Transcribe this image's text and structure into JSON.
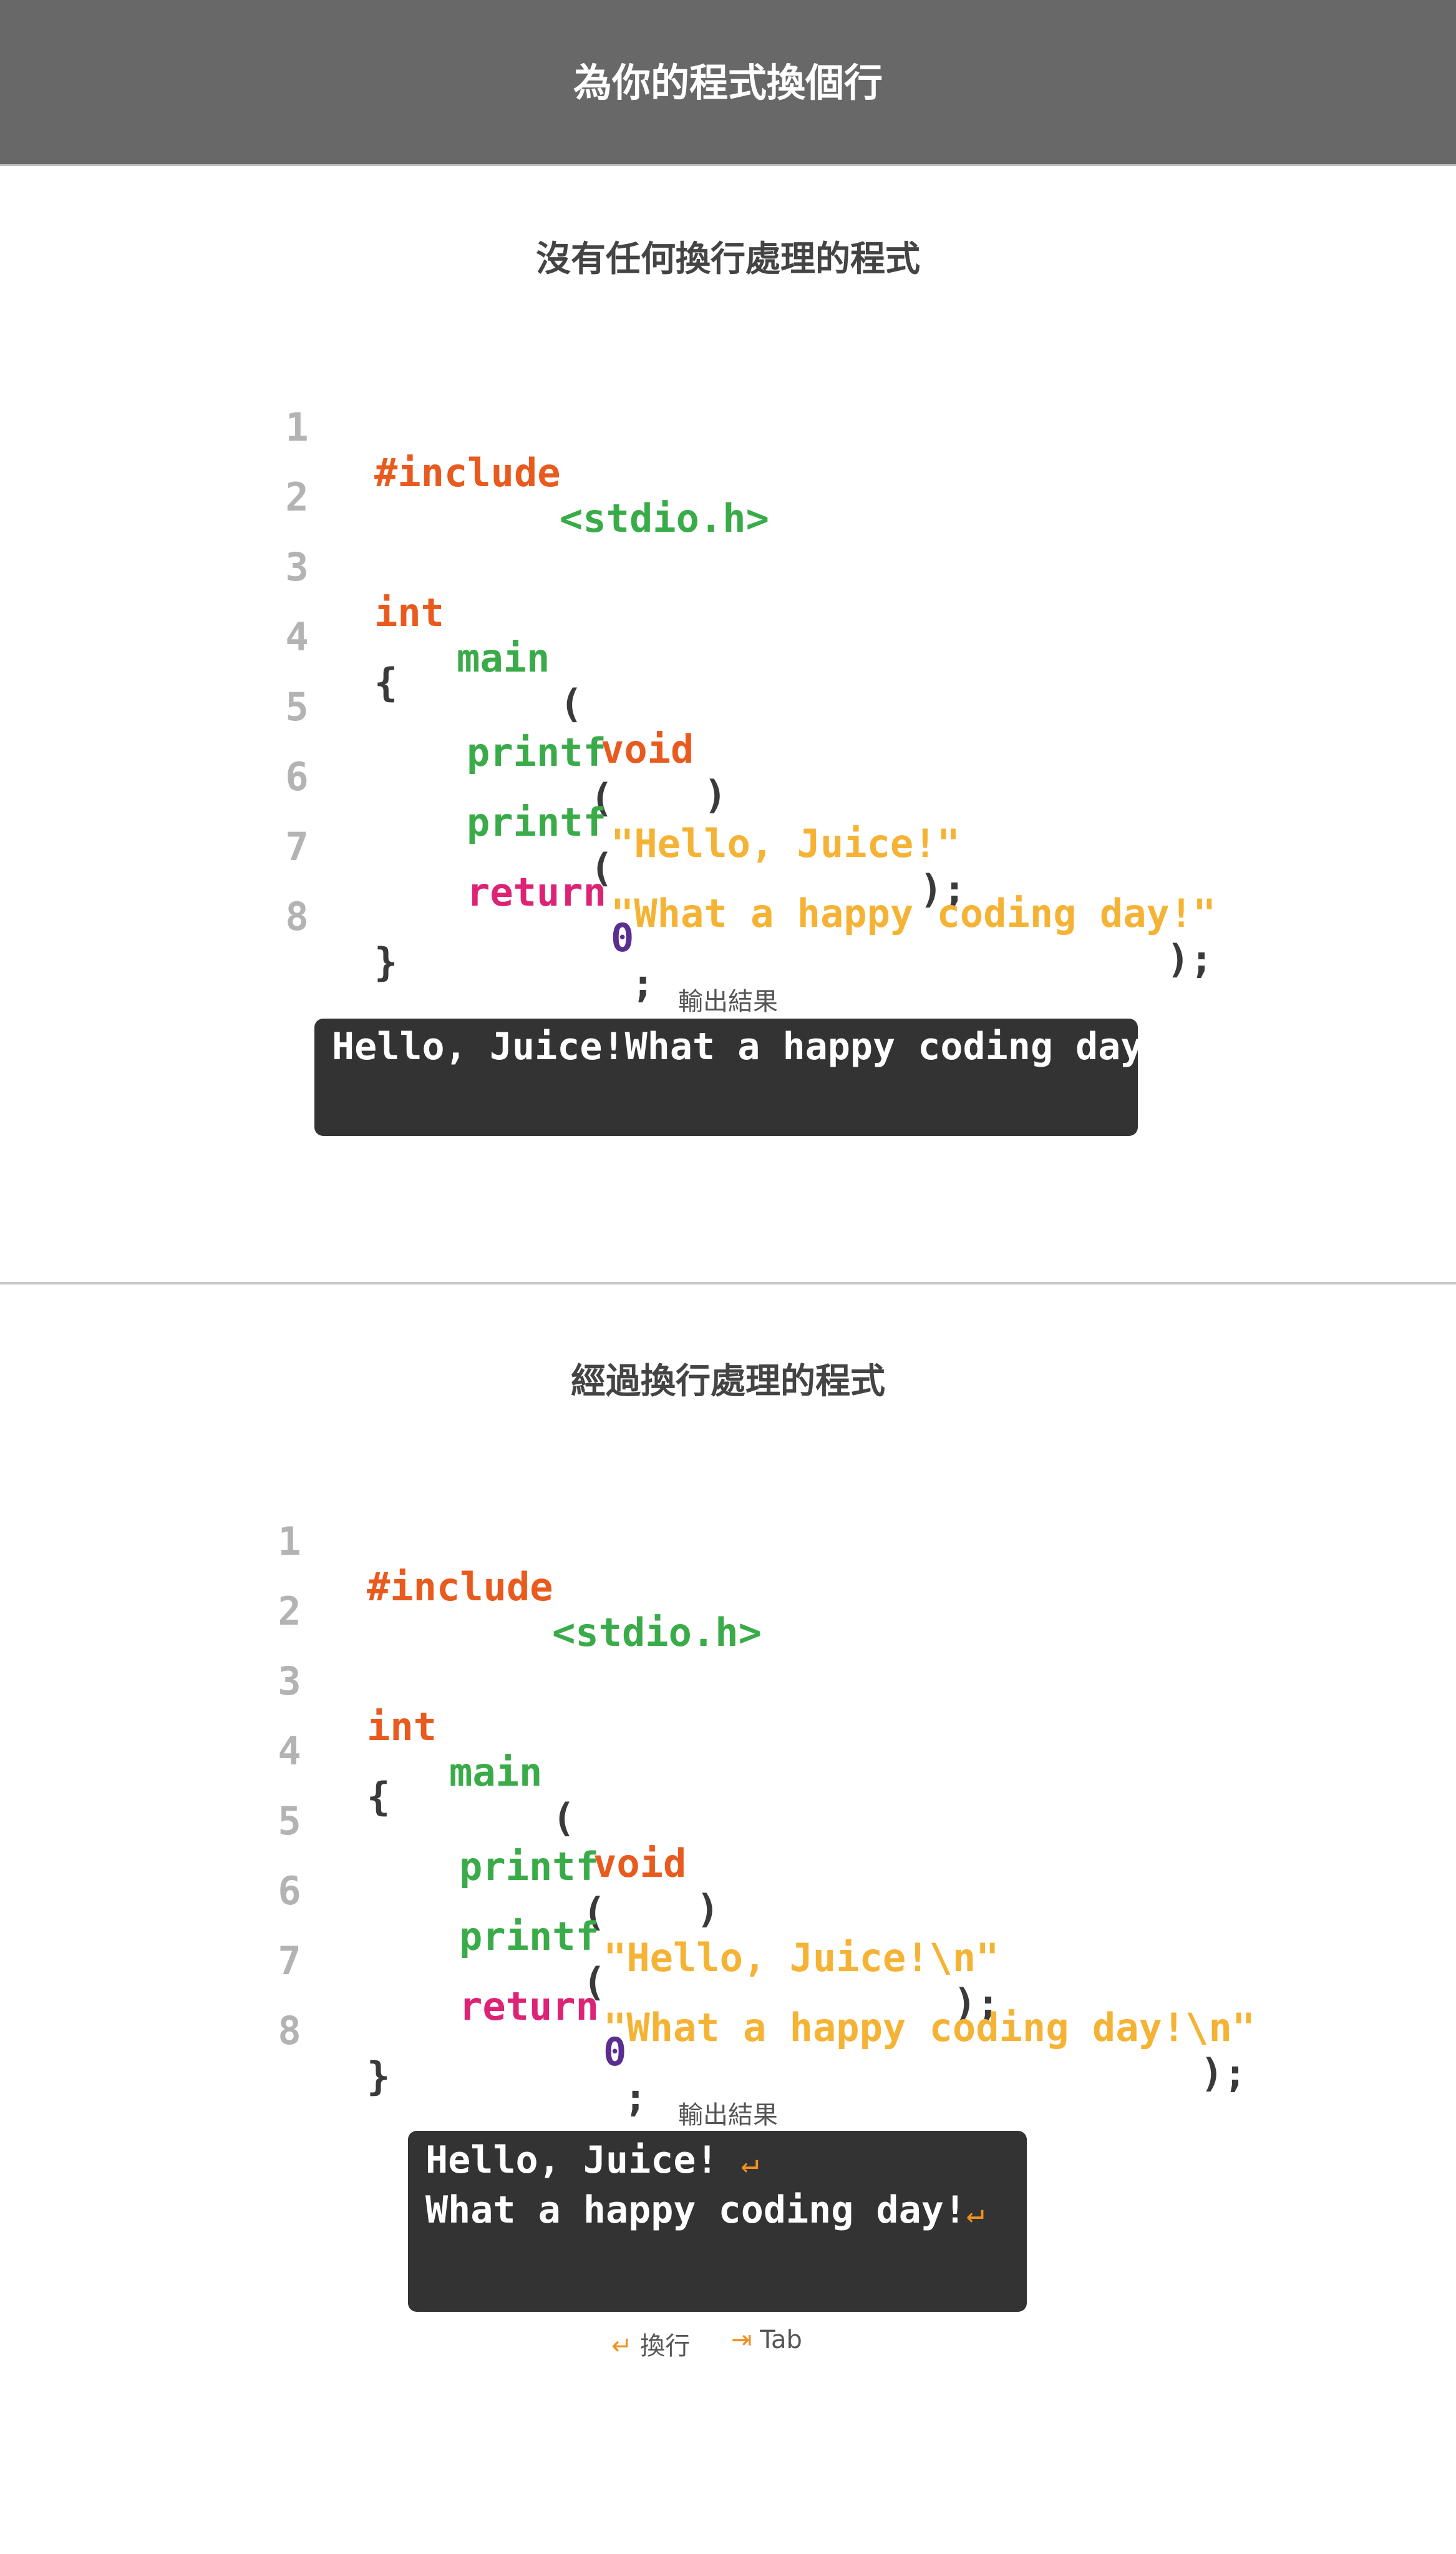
{
  "header": {
    "title": "為你的程式換個行"
  },
  "section1": {
    "title": "沒有任何換行處理的程式",
    "lines": [
      {
        "num": "1",
        "tokens": [
          "#include",
          "<stdio.h>"
        ]
      },
      {
        "num": "2"
      },
      {
        "num": "3",
        "tokens": [
          "int",
          "main",
          "(",
          "void",
          ")"
        ]
      },
      {
        "num": "4",
        "tokens": [
          "{"
        ]
      },
      {
        "num": "5",
        "tokens": [
          "printf",
          "(",
          "\"Hello, Juice!\"",
          ");"
        ]
      },
      {
        "num": "6",
        "tokens": [
          "printf",
          "(",
          "\"What a happy coding day!\"",
          ");"
        ]
      },
      {
        "num": "7",
        "tokens": [
          "return",
          "0",
          ";"
        ]
      },
      {
        "num": "8",
        "tokens": [
          "}"
        ]
      }
    ],
    "output_label": "輸出結果",
    "output_lines": [
      "Hello, Juice!What a happy coding day!"
    ]
  },
  "section2": {
    "title": "經過換行處理的程式",
    "lines": [
      {
        "num": "1",
        "tokens": [
          "#include",
          "<stdio.h>"
        ]
      },
      {
        "num": "2"
      },
      {
        "num": "3",
        "tokens": [
          "int",
          "main",
          "(",
          "void",
          ")"
        ]
      },
      {
        "num": "4",
        "tokens": [
          "{"
        ]
      },
      {
        "num": "5",
        "tokens": [
          "printf",
          "(",
          "\"Hello, Juice!\\n\"",
          ");"
        ]
      },
      {
        "num": "6",
        "tokens": [
          "printf",
          "(",
          "\"What a happy coding day!\\n\"",
          ");"
        ]
      },
      {
        "num": "7",
        "tokens": [
          "return",
          "0",
          ";"
        ]
      },
      {
        "num": "8",
        "tokens": [
          "}"
        ]
      }
    ],
    "output_label": "輸出結果",
    "output_lines": [
      "Hello, Juice!",
      "What a happy coding day!"
    ]
  },
  "legend": {
    "newline_symbol": "↵",
    "newline_label": "換行",
    "tab_symbol": "⇥",
    "tab_label": "Tab"
  },
  "colors": {
    "keyword": "#e85a1e",
    "function": "#3aab49",
    "string": "#f5b335",
    "return": "#dd2376",
    "number": "#5a2e8e",
    "header_bg": "#686868",
    "terminal_bg": "#333333"
  }
}
